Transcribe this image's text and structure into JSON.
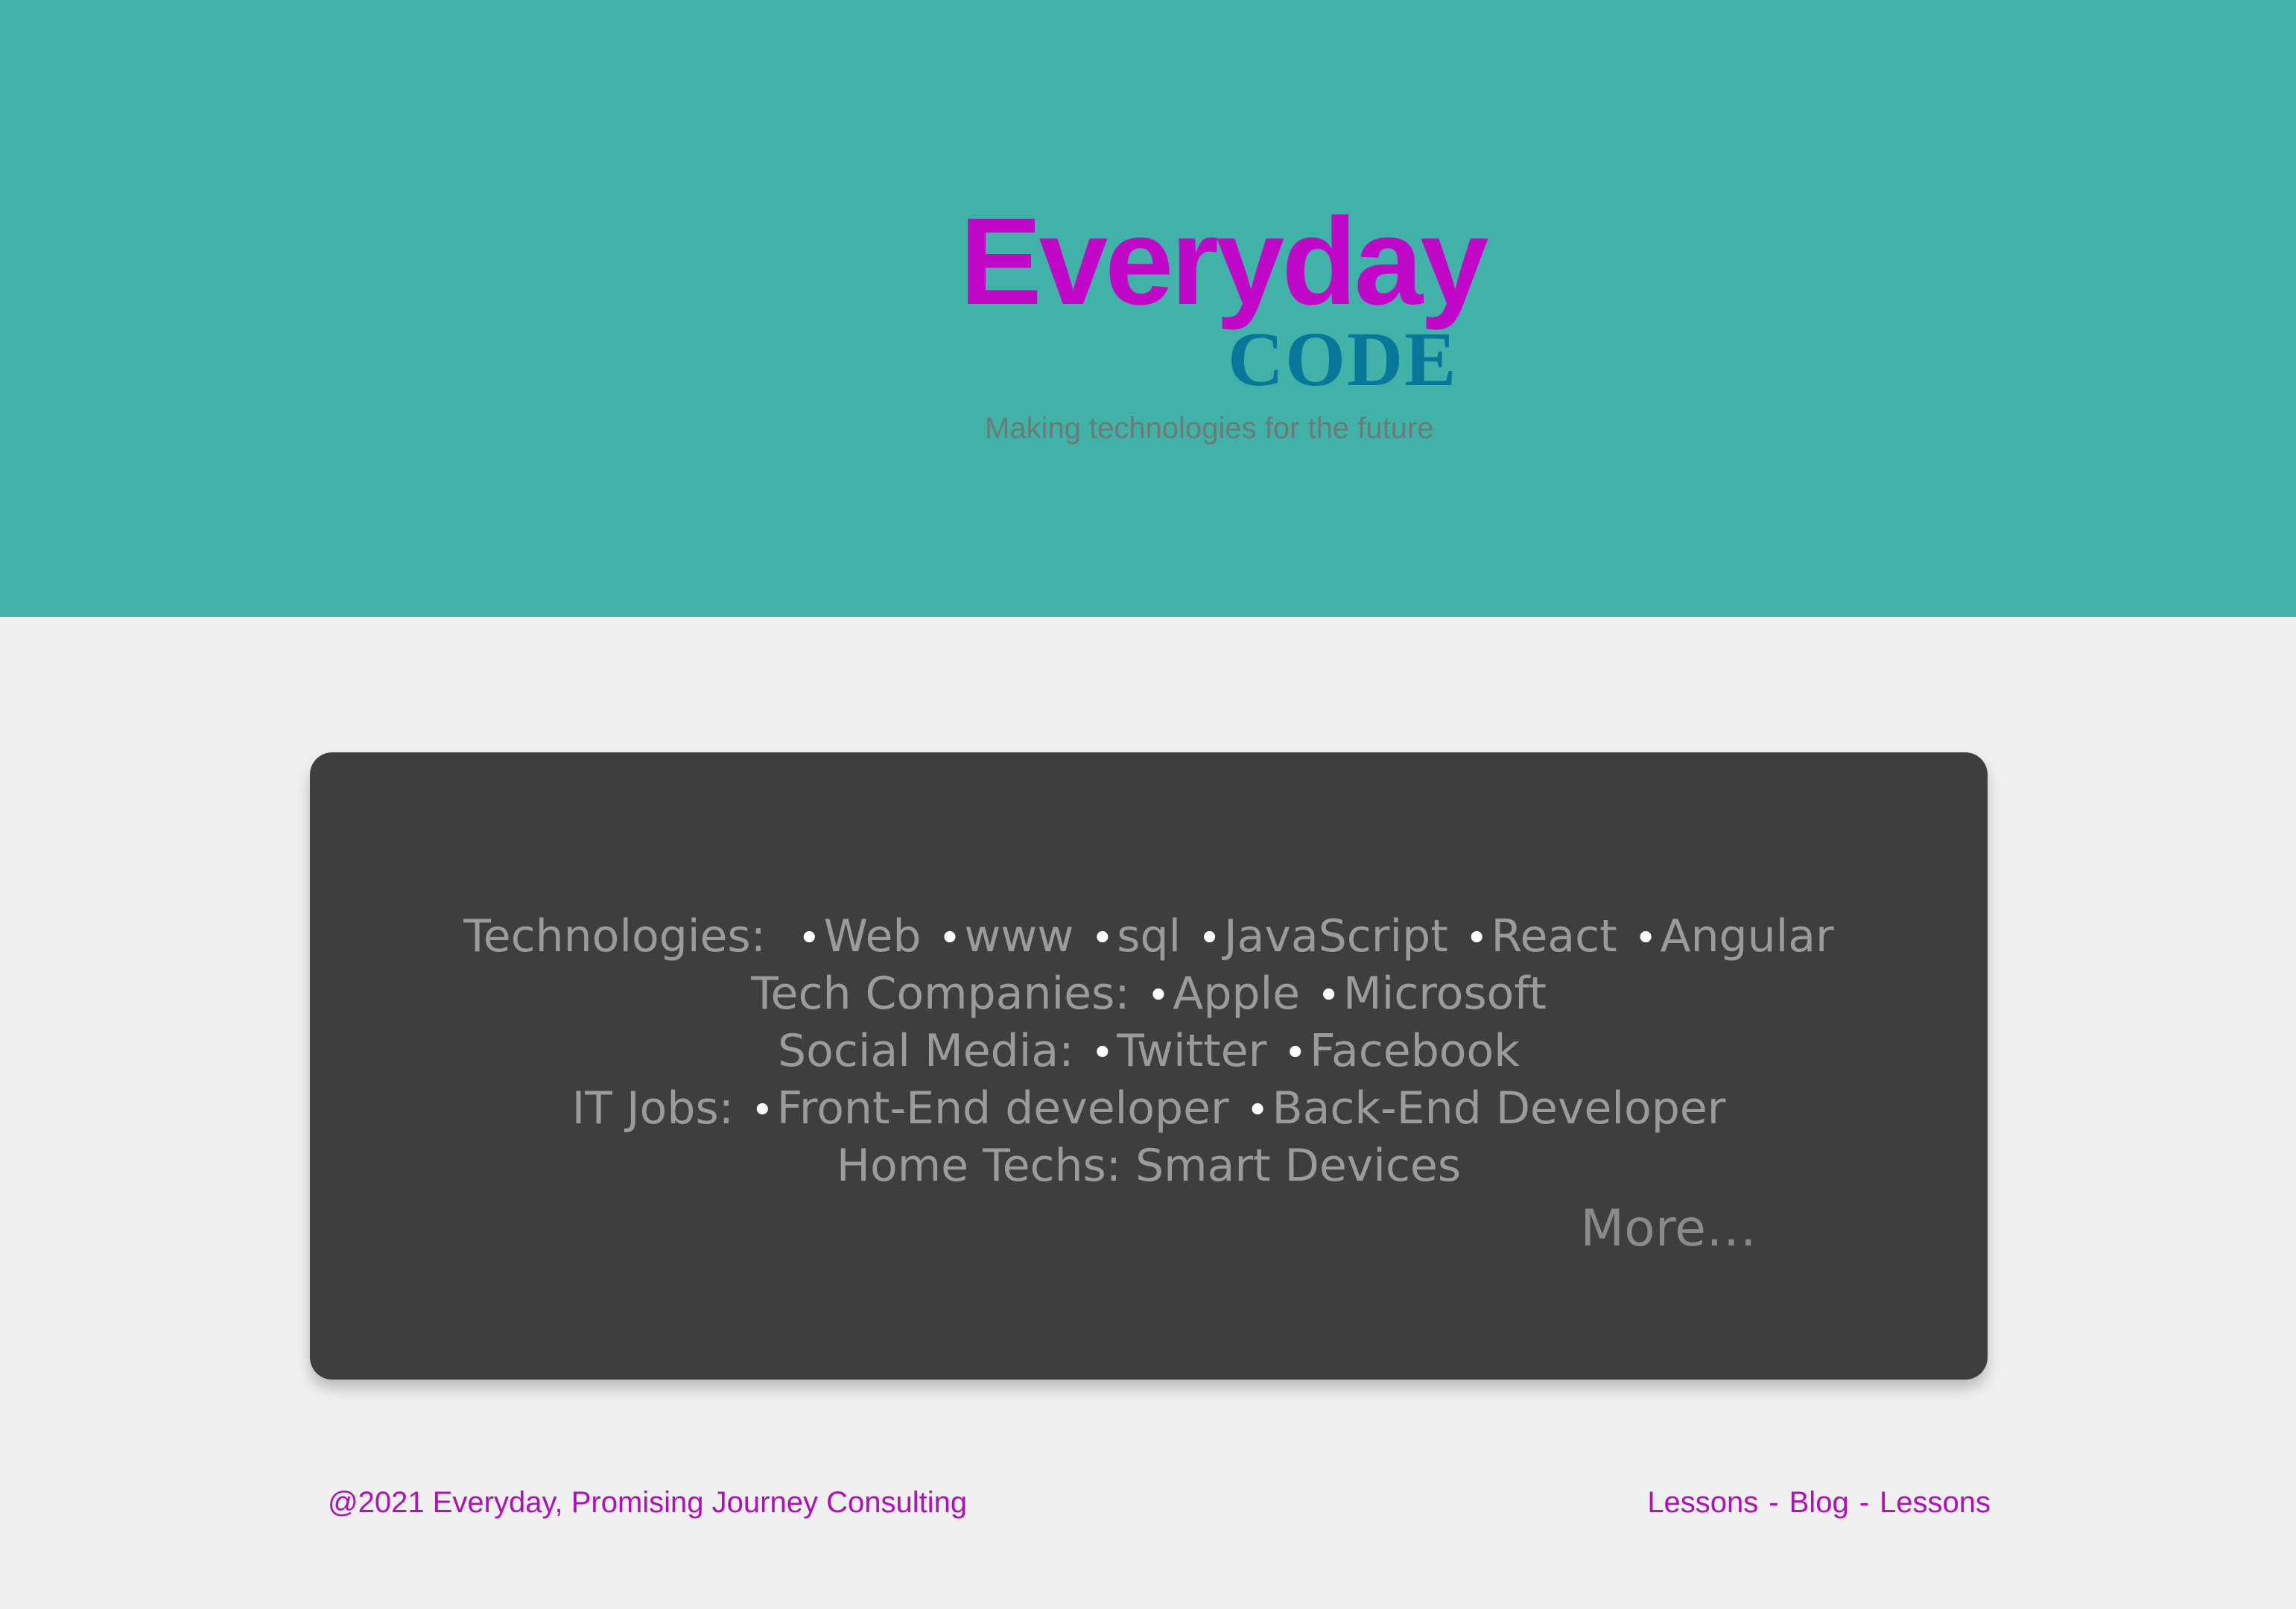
{
  "hero": {
    "logo_word": "Everyday",
    "logo_sub": "CODE",
    "tagline": "Making technologies for the future",
    "background": "#41b2a7",
    "logo_color": "#c108c9",
    "logo_sub_color": "#08789a"
  },
  "panel": {
    "lines": [
      {
        "label": "Technologies:",
        "items": [
          "Web",
          "www",
          "sql",
          "JavaScript",
          "React",
          "Angular"
        ]
      },
      {
        "label": "Tech Companies:",
        "items": [
          "Apple",
          "Microsoft"
        ]
      },
      {
        "label": "Social Media:",
        "items": [
          "Twitter",
          "Facebook"
        ]
      },
      {
        "label": "IT Jobs:",
        "items": [
          "Front-End developer",
          "Back-End Developer"
        ]
      },
      {
        "label": "Home Techs: Smart Devices",
        "items": []
      }
    ],
    "bullet": "•",
    "more": "More…",
    "background": "#3e3e3e"
  },
  "footer": {
    "copyright": "@2021 Everyday, Promising Journey Consulting",
    "links": [
      "Lessons",
      "Blog",
      "Lessons"
    ],
    "separator": "-",
    "color": "#b010b8"
  }
}
